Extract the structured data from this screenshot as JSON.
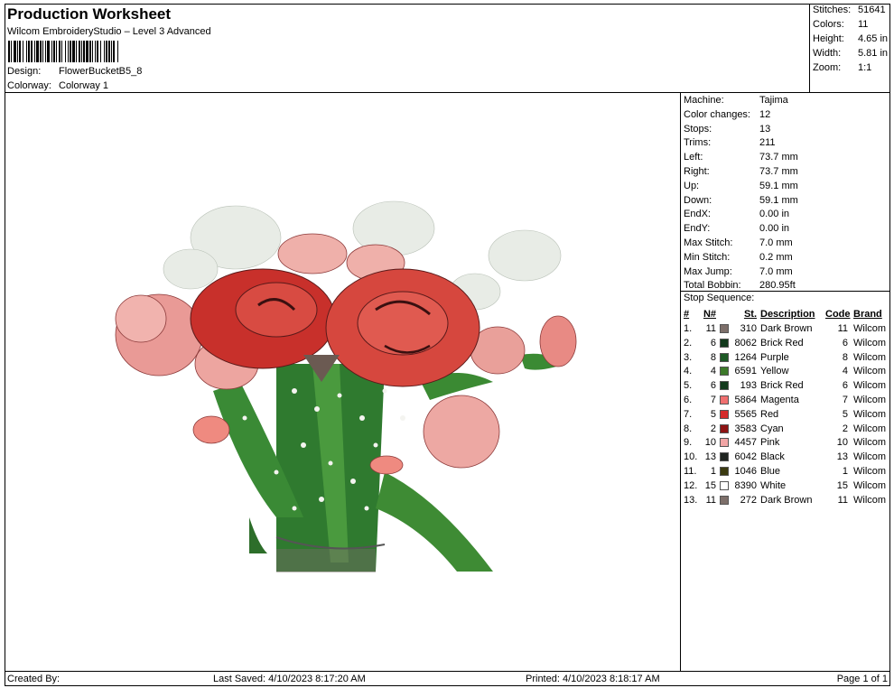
{
  "header": {
    "title": "Production Worksheet",
    "subtitle": "Wilcom EmbroideryStudio – Level 3 Advanced",
    "design_label": "Design:",
    "design_value": "FlowerBucketB5_8",
    "colorway_label": "Colorway:",
    "colorway_value": "Colorway 1"
  },
  "summary": [
    {
      "label": "Stitches:",
      "value": "51641"
    },
    {
      "label": "Colors:",
      "value": "11"
    },
    {
      "label": "Height:",
      "value": "4.65 in"
    },
    {
      "label": "Width:",
      "value": "5.81 in"
    },
    {
      "label": "Zoom:",
      "value": "1:1"
    }
  ],
  "machine_info": [
    {
      "label": "Machine:",
      "value": "Tajima"
    },
    {
      "label": "Color changes:",
      "value": "12"
    },
    {
      "label": "Stops:",
      "value": "13"
    },
    {
      "label": "Trims:",
      "value": "211"
    },
    {
      "label": "Left:",
      "value": "73.7 mm"
    },
    {
      "label": "Right:",
      "value": "73.7 mm"
    },
    {
      "label": "Up:",
      "value": "59.1 mm"
    },
    {
      "label": "Down:",
      "value": "59.1 mm"
    },
    {
      "label": "EndX:",
      "value": "0.00 in"
    },
    {
      "label": "EndY:",
      "value": "0.00 in"
    },
    {
      "label": "Max Stitch:",
      "value": "7.0 mm"
    },
    {
      "label": "Min Stitch:",
      "value": "0.2 mm"
    },
    {
      "label": "Max Jump:",
      "value": "7.0 mm"
    },
    {
      "label": "Total Bobbin:",
      "value": "280.95ft"
    }
  ],
  "stop_sequence": {
    "title": "Stop Sequence:",
    "headers": {
      "seq": "#",
      "n": "N#",
      "st": "St.",
      "desc": "Description",
      "code": "Code",
      "brand": "Brand"
    },
    "rows": [
      {
        "seq": "1.",
        "n": "11",
        "color": "#7d6f6a",
        "st": "310",
        "desc": "Dark Brown",
        "code": "11",
        "brand": "Wilcom"
      },
      {
        "seq": "2.",
        "n": "6",
        "color": "#123a1c",
        "st": "8062",
        "desc": "Brick Red",
        "code": "6",
        "brand": "Wilcom"
      },
      {
        "seq": "3.",
        "n": "8",
        "color": "#1e5a26",
        "st": "1264",
        "desc": "Purple",
        "code": "8",
        "brand": "Wilcom"
      },
      {
        "seq": "4.",
        "n": "4",
        "color": "#3d7a2a",
        "st": "6591",
        "desc": "Yellow",
        "code": "4",
        "brand": "Wilcom"
      },
      {
        "seq": "5.",
        "n": "6",
        "color": "#123a1c",
        "st": "193",
        "desc": "Brick Red",
        "code": "6",
        "brand": "Wilcom"
      },
      {
        "seq": "6.",
        "n": "7",
        "color": "#f07070",
        "st": "5864",
        "desc": "Magenta",
        "code": "7",
        "brand": "Wilcom"
      },
      {
        "seq": "7.",
        "n": "5",
        "color": "#d42c2c",
        "st": "5565",
        "desc": "Red",
        "code": "5",
        "brand": "Wilcom"
      },
      {
        "seq": "8.",
        "n": "2",
        "color": "#8e1414",
        "st": "3583",
        "desc": "Cyan",
        "code": "2",
        "brand": "Wilcom"
      },
      {
        "seq": "9.",
        "n": "10",
        "color": "#f2a6a6",
        "st": "4457",
        "desc": "Pink",
        "code": "10",
        "brand": "Wilcom"
      },
      {
        "seq": "10.",
        "n": "13",
        "color": "#1f2420",
        "st": "6042",
        "desc": "Black",
        "code": "13",
        "brand": "Wilcom"
      },
      {
        "seq": "11.",
        "n": "1",
        "color": "#3b3a10",
        "st": "1046",
        "desc": "Blue",
        "code": "1",
        "brand": "Wilcom"
      },
      {
        "seq": "12.",
        "n": "15",
        "color": "#ffffff",
        "st": "8390",
        "desc": "White",
        "code": "15",
        "brand": "Wilcom"
      },
      {
        "seq": "13.",
        "n": "11",
        "color": "#7d6f6a",
        "st": "272",
        "desc": "Dark Brown",
        "code": "11",
        "brand": "Wilcom"
      }
    ]
  },
  "footer": {
    "created_by": "Created By:",
    "last_saved": "Last Saved: 4/10/2023 8:17:20 AM",
    "printed": "Printed: 4/10/2023 8:18:17 AM",
    "page": "Page 1 of 1"
  }
}
